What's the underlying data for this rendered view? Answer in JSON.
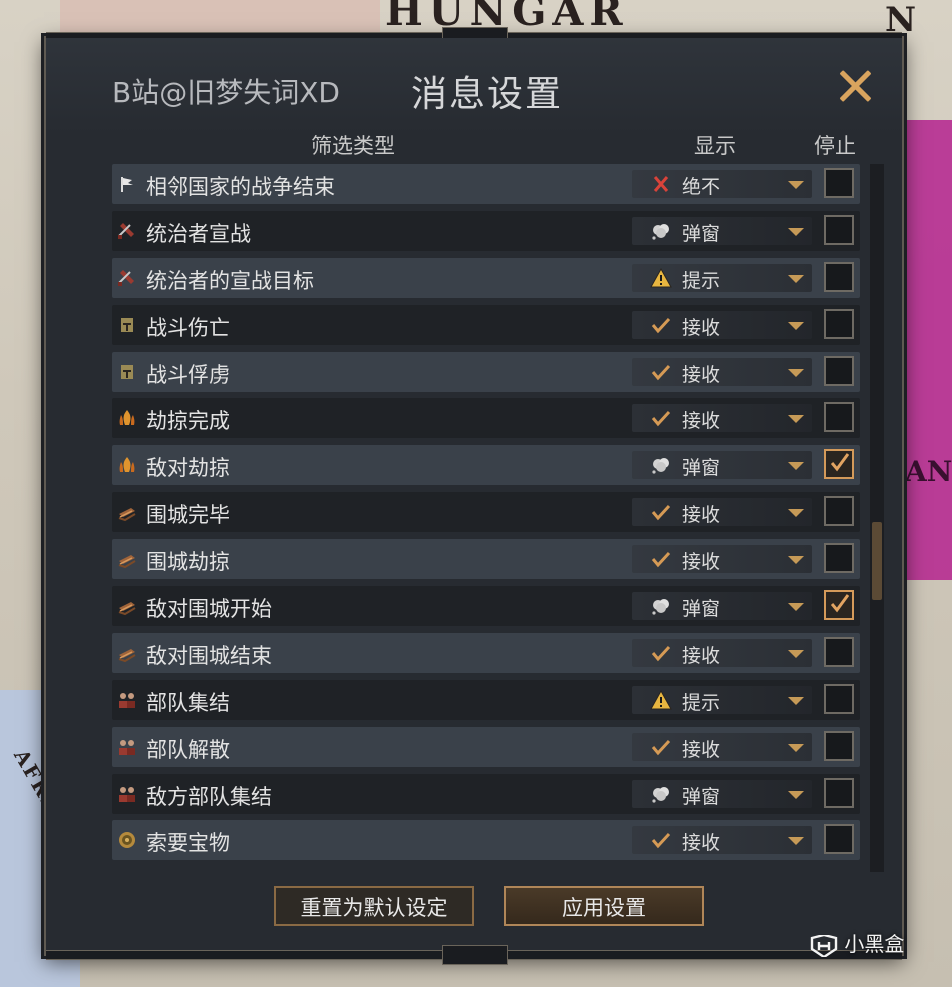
{
  "map": {
    "label_hungary": "HUNGAR",
    "label_north": "N",
    "label_africa": "AFRICA",
    "label_right": "AN"
  },
  "dialog": {
    "subtitle": "B站@旧梦失词XD",
    "title": "消息设置",
    "close_icon": "close-x-icon",
    "columns": {
      "filter": "筛选类型",
      "display": "显示",
      "stop": "停止"
    },
    "rows": [
      {
        "label": "相邻国家的战争结束",
        "icon": "white-flag-icon",
        "display": "绝不",
        "display_icon": "red-x-icon",
        "stop": false
      },
      {
        "label": "统治者宣战",
        "icon": "war-scroll-icon",
        "display": "弹窗",
        "display_icon": "cloud-icon",
        "stop": false
      },
      {
        "label": "统治者的宣战目标",
        "icon": "war-scroll-icon",
        "display": "提示",
        "display_icon": "warning-icon",
        "stop": false
      },
      {
        "label": "战斗伤亡",
        "icon": "helmet-icon",
        "display": "接收",
        "display_icon": "checkmark-icon",
        "stop": false
      },
      {
        "label": "战斗俘虏",
        "icon": "helmet-icon",
        "display": "接收",
        "display_icon": "checkmark-icon",
        "stop": false
      },
      {
        "label": "劫掠完成",
        "icon": "fire-icon",
        "display": "接收",
        "display_icon": "checkmark-icon",
        "stop": false
      },
      {
        "label": "敌对劫掠",
        "icon": "fire-icon",
        "display": "弹窗",
        "display_icon": "cloud-icon",
        "stop": true
      },
      {
        "label": "围城完毕",
        "icon": "siege-ram-icon",
        "display": "接收",
        "display_icon": "checkmark-icon",
        "stop": false
      },
      {
        "label": "围城劫掠",
        "icon": "siege-ram-icon",
        "display": "接收",
        "display_icon": "checkmark-icon",
        "stop": false
      },
      {
        "label": "敌对围城开始",
        "icon": "siege-ram-icon",
        "display": "弹窗",
        "display_icon": "cloud-icon",
        "stop": true
      },
      {
        "label": "敌对围城结束",
        "icon": "siege-ram-icon",
        "display": "接收",
        "display_icon": "checkmark-icon",
        "stop": false
      },
      {
        "label": "部队集结",
        "icon": "soldiers-icon",
        "display": "提示",
        "display_icon": "warning-icon",
        "stop": false
      },
      {
        "label": "部队解散",
        "icon": "soldiers-icon",
        "display": "接收",
        "display_icon": "checkmark-icon",
        "stop": false
      },
      {
        "label": "敌方部队集结",
        "icon": "soldiers-icon",
        "display": "弹窗",
        "display_icon": "cloud-icon",
        "stop": false
      },
      {
        "label": "索要宝物",
        "icon": "treasure-icon",
        "display": "接收",
        "display_icon": "checkmark-icon",
        "stop": false
      }
    ],
    "buttons": {
      "reset": "重置为默认设定",
      "apply": "应用设置"
    }
  },
  "watermark": {
    "text": "小黑盒"
  },
  "colors": {
    "accent": "#c69a57",
    "panel_bg": "#272b31",
    "row_light": "#3a414a",
    "row_dark": "#1f2226"
  }
}
